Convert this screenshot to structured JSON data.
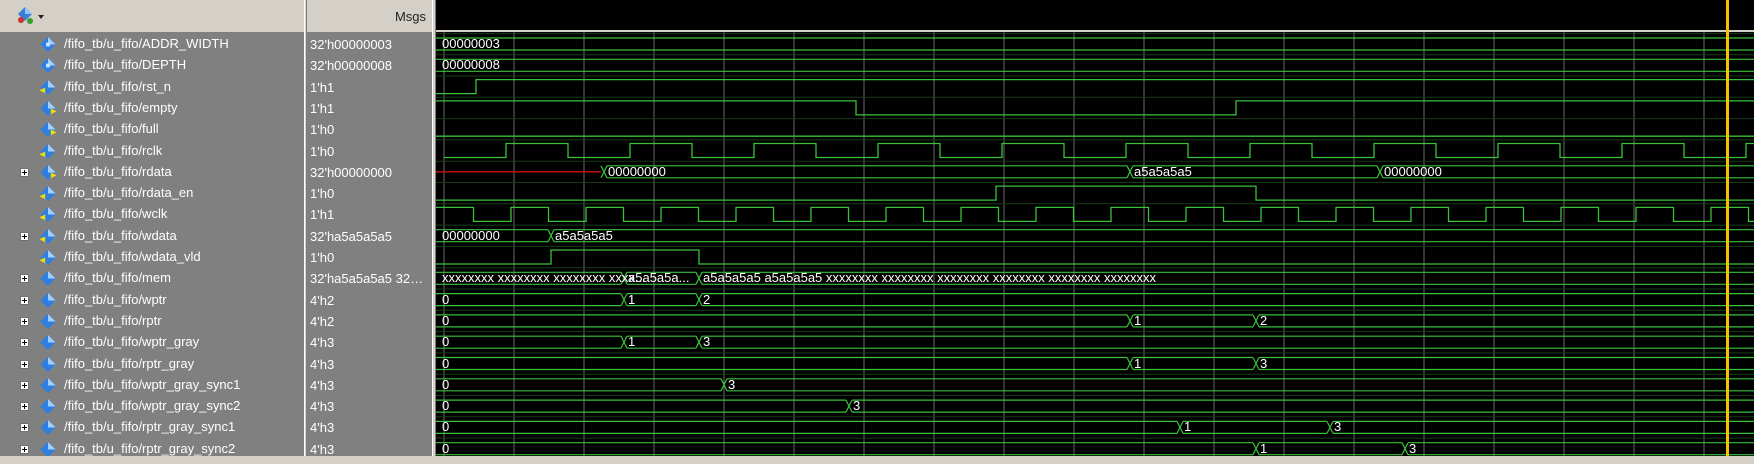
{
  "header": {
    "msgs_label": "Msgs"
  },
  "colors": {
    "wave_green": "#39c13a",
    "invalid_red": "#d01010",
    "cursor_yellow": "#f5c000",
    "label_white": "#ffffff"
  },
  "signals": [
    {
      "name": "/fifo_tb/u_fifo/ADDR_WIDTH",
      "value": "32'h00000003",
      "expandable": false,
      "icon": "parameter-icon"
    },
    {
      "name": "/fifo_tb/u_fifo/DEPTH",
      "value": "32'h00000008",
      "expandable": false,
      "icon": "parameter-icon"
    },
    {
      "name": "/fifo_tb/u_fifo/rst_n",
      "value": "1'h1",
      "expandable": false,
      "icon": "input-port-icon"
    },
    {
      "name": "/fifo_tb/u_fifo/empty",
      "value": "1'h1",
      "expandable": false,
      "icon": "output-port-icon"
    },
    {
      "name": "/fifo_tb/u_fifo/full",
      "value": "1'h0",
      "expandable": false,
      "icon": "output-port-icon"
    },
    {
      "name": "/fifo_tb/u_fifo/rclk",
      "value": "1'h0",
      "expandable": false,
      "icon": "input-port-icon"
    },
    {
      "name": "/fifo_tb/u_fifo/rdata",
      "value": "32'h00000000",
      "expandable": true,
      "icon": "output-port-icon"
    },
    {
      "name": "/fifo_tb/u_fifo/rdata_en",
      "value": "1'h0",
      "expandable": false,
      "icon": "input-port-icon"
    },
    {
      "name": "/fifo_tb/u_fifo/wclk",
      "value": "1'h1",
      "expandable": false,
      "icon": "input-port-icon"
    },
    {
      "name": "/fifo_tb/u_fifo/wdata",
      "value": "32'ha5a5a5a5",
      "expandable": true,
      "icon": "input-port-icon"
    },
    {
      "name": "/fifo_tb/u_fifo/wdata_vld",
      "value": "1'h0",
      "expandable": false,
      "icon": "input-port-icon"
    },
    {
      "name": "/fifo_tb/u_fifo/mem",
      "value": "32'ha5a5a5a5 32…",
      "expandable": true,
      "icon": "signal-icon"
    },
    {
      "name": "/fifo_tb/u_fifo/wptr",
      "value": "4'h2",
      "expandable": true,
      "icon": "signal-icon"
    },
    {
      "name": "/fifo_tb/u_fifo/rptr",
      "value": "4'h2",
      "expandable": true,
      "icon": "signal-icon"
    },
    {
      "name": "/fifo_tb/u_fifo/wptr_gray",
      "value": "4'h3",
      "expandable": true,
      "icon": "signal-icon"
    },
    {
      "name": "/fifo_tb/u_fifo/rptr_gray",
      "value": "4'h3",
      "expandable": true,
      "icon": "signal-icon"
    },
    {
      "name": "/fifo_tb/u_fifo/wptr_gray_sync1",
      "value": "4'h3",
      "expandable": true,
      "icon": "signal-icon"
    },
    {
      "name": "/fifo_tb/u_fifo/wptr_gray_sync2",
      "value": "4'h3",
      "expandable": true,
      "icon": "signal-icon"
    },
    {
      "name": "/fifo_tb/u_fifo/rptr_gray_sync1",
      "value": "4'h3",
      "expandable": true,
      "icon": "signal-icon"
    },
    {
      "name": "/fifo_tb/u_fifo/rptr_gray_sync2",
      "value": "4'h3",
      "expandable": true,
      "icon": "signal-icon"
    }
  ],
  "wave_labels": {
    "addr_width": [
      "00000003"
    ],
    "depth": [
      "00000008"
    ],
    "rdata": [
      "00000000",
      "a5a5a5a5",
      "00000000"
    ],
    "wdata": [
      "00000000",
      "a5a5a5a5"
    ],
    "mem": [
      "xxxxxxxx xxxxxxxx xxxxxxxx xxxx...",
      "a5a5a5a...",
      "a5a5a5a5 a5a5a5a5 xxxxxxxx xxxxxxxx xxxxxxxx xxxxxxxx xxxxxxxx xxxxxxxx"
    ],
    "wptr": [
      "0",
      "1",
      "2"
    ],
    "rptr": [
      "0",
      "1",
      "2"
    ],
    "wptr_gray": [
      "0",
      "1",
      "3"
    ],
    "rptr_gray": [
      "0",
      "1",
      "3"
    ],
    "wptr_gray_sync1": [
      "0",
      "3"
    ],
    "wptr_gray_sync2": [
      "0",
      "3"
    ],
    "rptr_gray_sync1": [
      "0",
      "1",
      "3"
    ],
    "rptr_gray_sync2": [
      "0",
      "1",
      "3"
    ]
  }
}
